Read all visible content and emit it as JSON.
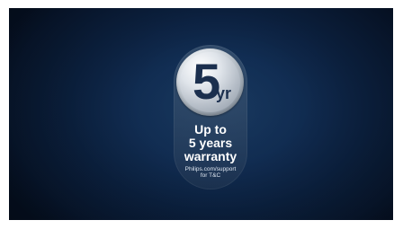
{
  "badge": {
    "number": "5",
    "unit": "yr",
    "headline": [
      "Up to",
      "5 years",
      "warranty"
    ],
    "note": [
      "Philips.com/support",
      "for T&C"
    ]
  },
  "colors": {
    "background": "#0c2344",
    "text": "#ffffff",
    "medal": "#d5dbe1",
    "medal_text": "#1b2f4e"
  }
}
